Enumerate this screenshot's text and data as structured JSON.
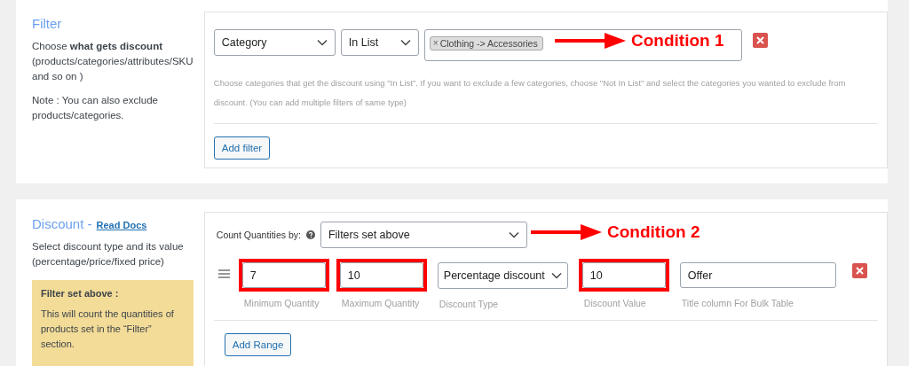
{
  "filter": {
    "title": "Filter",
    "description": "Choose **what gets discount** (products/categories/attributes/SKU and so on )",
    "note": "Note : You can also exclude products/categories.",
    "conditions": [
      {
        "type": "Category",
        "operator": "In List",
        "tags": [
          {
            "remove": "×",
            "label": "Clothing -> Accessories"
          }
        ],
        "remove": true
      }
    ],
    "help": "Choose categories that get the discount using \"In List\". If you want to exclude a few categories, choose \"Not In List\" and select the categories you wanted to exclude from discount. (You can add multiple filters of same type)",
    "add_button": "Add filter"
  },
  "discount": {
    "title": "Discount -",
    "link": "Read Docs",
    "description": "Select discount type and its value (percentage/price/fixed price)",
    "info": {
      "title": "Filter set above :",
      "text": "This will count the quantities of products set in the “Filter” section."
    },
    "count_label": "Count Quantities by:",
    "count_select": "Filters set above",
    "ranges": [
      {
        "fields": [
          {
            "kind": "input",
            "value": "7",
            "caption": "Minimum Quantity",
            "highlighted": true
          },
          {
            "kind": "input",
            "value": "10",
            "caption": "Maximum Quantity",
            "highlighted": true
          },
          {
            "kind": "select",
            "value": "Percentage discount",
            "caption": "Discount Type",
            "highlighted": false
          },
          {
            "kind": "input",
            "value": "10",
            "caption": "Discount Value",
            "highlighted": true
          },
          {
            "kind": "wide",
            "value": "Offer",
            "caption": "Title column For Bulk Table",
            "highlighted": false
          }
        ],
        "remove": true
      }
    ],
    "add_button": "Add Range"
  },
  "annotations": [
    {
      "label": "Condition 1"
    },
    {
      "label": "Condition 2"
    }
  ]
}
